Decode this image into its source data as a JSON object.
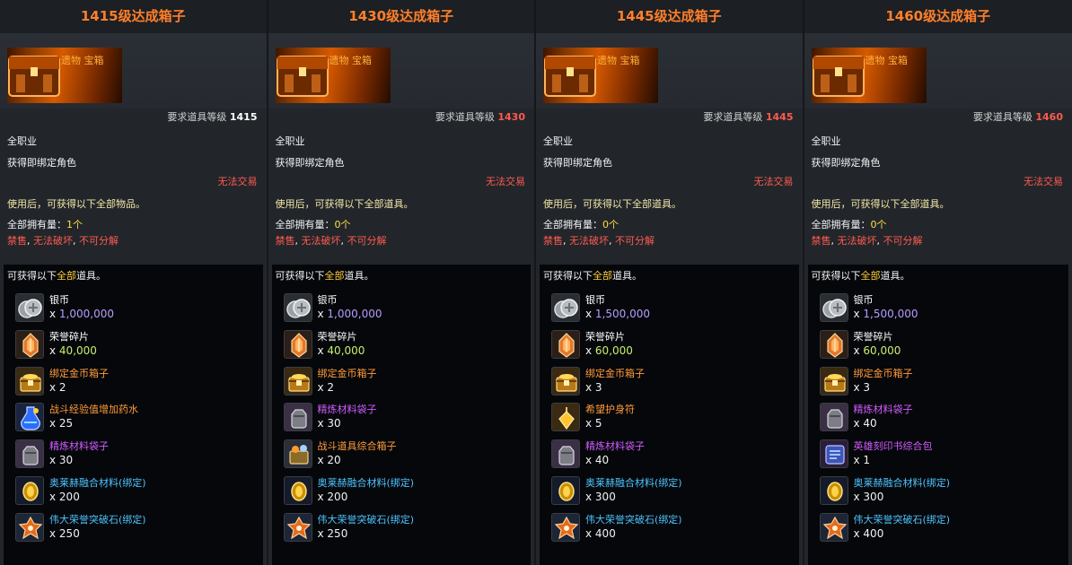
{
  "columns": [
    {
      "title": "1415级达成箱子",
      "category": "遗物 宝箱",
      "req_label": "要求道具等级",
      "req_level": "1415",
      "req_level_color": "#ffffff",
      "job": "全职业",
      "bind": "获得即绑定角色",
      "no_trade": "无法交易",
      "use_desc": "使用后，可获得以下全部物品。",
      "owned_label": "全部拥有量：",
      "owned_value": "1个",
      "flag_1": "禁售",
      "flag_sep": ", ",
      "flag_2": "无法破坏",
      "flag_3": "不可分解",
      "panel_pre": "可获得以下",
      "panel_hl": "全部",
      "panel_post": "道具。",
      "items": [
        {
          "icon": "silver-coin-icon",
          "name": "银币",
          "qty_prefix": "x ",
          "qty": "1,000,000",
          "name_class": "q-silver",
          "qty_class": "v-purple"
        },
        {
          "icon": "honor-shard-icon",
          "name": "荣誉碎片",
          "qty_prefix": "x ",
          "qty": "40,000",
          "name_class": "q-silver",
          "qty_class": "v-green"
        },
        {
          "icon": "gold-chest-icon",
          "name": "绑定金币箱子",
          "qty_prefix": "x ",
          "qty": "2",
          "name_class": "q-orange",
          "qty_class": ""
        },
        {
          "icon": "potion-icon",
          "name": "战斗经验值增加药水",
          "qty_prefix": "x ",
          "qty": "25",
          "name_class": "q-orange",
          "qty_class": ""
        },
        {
          "icon": "material-bag-icon",
          "name": "精炼材料袋子",
          "qty_prefix": "x ",
          "qty": "30",
          "name_class": "q-purple",
          "qty_class": ""
        },
        {
          "icon": "fusion-material-icon",
          "name": "奥莱赫融合材料(绑定)",
          "qty_prefix": "x ",
          "qty": "200",
          "name_class": "q-blue",
          "qty_class": ""
        },
        {
          "icon": "breakthrough-stone-icon",
          "name": "伟大荣誉突破石(绑定)",
          "qty_prefix": "x ",
          "qty": "250",
          "name_class": "q-blue",
          "qty_class": ""
        }
      ]
    },
    {
      "title": "1430级达成箱子",
      "category": "遗物 宝箱",
      "req_label": "要求道具等级",
      "req_level": "1430",
      "req_level_color": "#ff5a4e",
      "job": "全职业",
      "bind": "获得即绑定角色",
      "no_trade": "无法交易",
      "use_desc": "使用后，可获得以下全部道具。",
      "owned_label": "全部拥有量：",
      "owned_value": "0个",
      "flag_1": "禁售",
      "flag_sep": ", ",
      "flag_2": "无法破坏",
      "flag_3": "不可分解",
      "panel_pre": "可获得以下",
      "panel_hl": "全部",
      "panel_post": "道具。",
      "items": [
        {
          "icon": "silver-coin-icon",
          "name": "银币",
          "qty_prefix": "x ",
          "qty": "1,000,000",
          "name_class": "q-silver",
          "qty_class": "v-purple"
        },
        {
          "icon": "honor-shard-icon",
          "name": "荣誉碎片",
          "qty_prefix": "x ",
          "qty": "40,000",
          "name_class": "q-silver",
          "qty_class": "v-green"
        },
        {
          "icon": "gold-chest-icon",
          "name": "绑定金币箱子",
          "qty_prefix": "x ",
          "qty": "2",
          "name_class": "q-orange",
          "qty_class": ""
        },
        {
          "icon": "material-bag-icon",
          "name": "精炼材料袋子",
          "qty_prefix": "x ",
          "qty": "30",
          "name_class": "q-purple",
          "qty_class": ""
        },
        {
          "icon": "battle-item-chest-icon",
          "name": "战斗道具综合箱子",
          "qty_prefix": "x ",
          "qty": "20",
          "name_class": "q-orange",
          "qty_class": ""
        },
        {
          "icon": "fusion-material-icon",
          "name": "奥莱赫融合材料(绑定)",
          "qty_prefix": "x ",
          "qty": "200",
          "name_class": "q-blue",
          "qty_class": ""
        },
        {
          "icon": "breakthrough-stone-icon",
          "name": "伟大荣誉突破石(绑定)",
          "qty_prefix": "x ",
          "qty": "250",
          "name_class": "q-blue",
          "qty_class": ""
        }
      ]
    },
    {
      "title": "1445级达成箱子",
      "category": "遗物 宝箱",
      "req_label": "要求道具等级",
      "req_level": "1445",
      "req_level_color": "#ff5a4e",
      "job": "全职业",
      "bind": "获得即绑定角色",
      "no_trade": "无法交易",
      "use_desc": "使用后，可获得以下全部道具。",
      "owned_label": "全部拥有量：",
      "owned_value": "0个",
      "flag_1": "禁售",
      "flag_sep": ", ",
      "flag_2": "无法破坏",
      "flag_3": "不可分解",
      "panel_pre": "可获得以下",
      "panel_hl": "全部",
      "panel_post": "道具。",
      "items": [
        {
          "icon": "silver-coin-icon",
          "name": "银币",
          "qty_prefix": "x ",
          "qty": "1,500,000",
          "name_class": "q-silver",
          "qty_class": "v-purple"
        },
        {
          "icon": "honor-shard-icon",
          "name": "荣誉碎片",
          "qty_prefix": "x ",
          "qty": "60,000",
          "name_class": "q-silver",
          "qty_class": "v-green"
        },
        {
          "icon": "gold-chest-icon",
          "name": "绑定金币箱子",
          "qty_prefix": "x ",
          "qty": "3",
          "name_class": "q-orange",
          "qty_class": ""
        },
        {
          "icon": "amulet-icon",
          "name": "希望护身符",
          "qty_prefix": "x ",
          "qty": "5",
          "name_class": "q-orange",
          "qty_class": ""
        },
        {
          "icon": "material-bag-icon",
          "name": "精炼材料袋子",
          "qty_prefix": "x ",
          "qty": "40",
          "name_class": "q-purple",
          "qty_class": ""
        },
        {
          "icon": "fusion-material-icon",
          "name": "奥莱赫融合材料(绑定)",
          "qty_prefix": "x ",
          "qty": "300",
          "name_class": "q-blue",
          "qty_class": ""
        },
        {
          "icon": "breakthrough-stone-icon",
          "name": "伟大荣誉突破石(绑定)",
          "qty_prefix": "x ",
          "qty": "400",
          "name_class": "q-blue",
          "qty_class": ""
        }
      ]
    },
    {
      "title": "1460级达成箱子",
      "category": "遗物 宝箱",
      "req_label": "要求道具等级",
      "req_level": "1460",
      "req_level_color": "#ff5a4e",
      "job": "全职业",
      "bind": "获得即绑定角色",
      "no_trade": "无法交易",
      "use_desc": "使用后，可获得以下全部道具。",
      "owned_label": "全部拥有量：",
      "owned_value": "0个",
      "flag_1": "禁售",
      "flag_sep": ", ",
      "flag_2": "无法破坏",
      "flag_3": "不可分解",
      "panel_pre": "可获得以下",
      "panel_hl": "全部",
      "panel_post": "道具。",
      "items": [
        {
          "icon": "silver-coin-icon",
          "name": "银币",
          "qty_prefix": "x ",
          "qty": "1,500,000",
          "name_class": "q-silver",
          "qty_class": "v-purple"
        },
        {
          "icon": "honor-shard-icon",
          "name": "荣誉碎片",
          "qty_prefix": "x ",
          "qty": "60,000",
          "name_class": "q-silver",
          "qty_class": "v-green"
        },
        {
          "icon": "gold-chest-icon",
          "name": "绑定金币箱子",
          "qty_prefix": "x ",
          "qty": "3",
          "name_class": "q-orange",
          "qty_class": ""
        },
        {
          "icon": "material-bag-icon",
          "name": "精炼材料袋子",
          "qty_prefix": "x ",
          "qty": "40",
          "name_class": "q-purple",
          "qty_class": ""
        },
        {
          "icon": "engraving-pack-icon",
          "name": "英雄刻印书综合包",
          "qty_prefix": "x ",
          "qty": "1",
          "name_class": "q-purple",
          "qty_class": ""
        },
        {
          "icon": "fusion-material-icon",
          "name": "奥莱赫融合材料(绑定)",
          "qty_prefix": "x ",
          "qty": "300",
          "name_class": "q-blue",
          "qty_class": ""
        },
        {
          "icon": "breakthrough-stone-icon",
          "name": "伟大荣誉突破石(绑定)",
          "qty_prefix": "x ",
          "qty": "400",
          "name_class": "q-blue",
          "qty_class": ""
        }
      ]
    }
  ]
}
